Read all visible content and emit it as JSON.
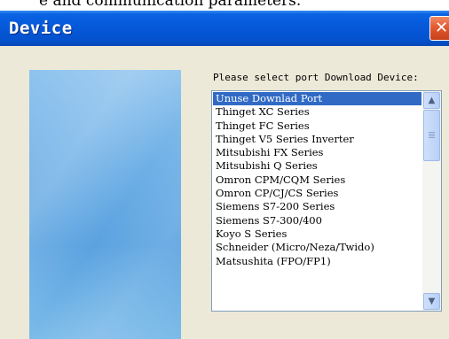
{
  "background_caption": "e and communication parameters.",
  "window": {
    "title": "Device",
    "close_glyph": "✕"
  },
  "panel": {
    "prompt": "Please select port Download Device:"
  },
  "devices": {
    "items": [
      {
        "label": "Unuse Downlad Port",
        "selected": true
      },
      {
        "label": "Thinget XC Series",
        "selected": false
      },
      {
        "label": "Thinget FC Series",
        "selected": false
      },
      {
        "label": "Thinget V5 Series Inverter",
        "selected": false
      },
      {
        "label": "Mitsubishi FX Series",
        "selected": false
      },
      {
        "label": "Mitsubishi Q Series",
        "selected": false
      },
      {
        "label": "Omron CPM/CQM Series",
        "selected": false
      },
      {
        "label": "Omron CP/CJ/CS Series",
        "selected": false
      },
      {
        "label": "Siemens S7-200 Series",
        "selected": false
      },
      {
        "label": "Siemens S7-300/400",
        "selected": false
      },
      {
        "label": "Koyo S Series",
        "selected": false
      },
      {
        "label": "Schneider (Micro/Neza/Twido)",
        "selected": false
      },
      {
        "label": "Matsushita (FPO/FP1)",
        "selected": false
      }
    ]
  },
  "scrollbar": {
    "up_icon": "scroll-up-arrow-icon",
    "down_icon": "scroll-down-arrow-icon",
    "up_glyph": "▲",
    "down_glyph": "▼"
  },
  "colors": {
    "titlebar": "#0558d8",
    "selection": "#316ac5",
    "close_button": "#e35a30",
    "dialog_bg": "#ece9d8"
  }
}
